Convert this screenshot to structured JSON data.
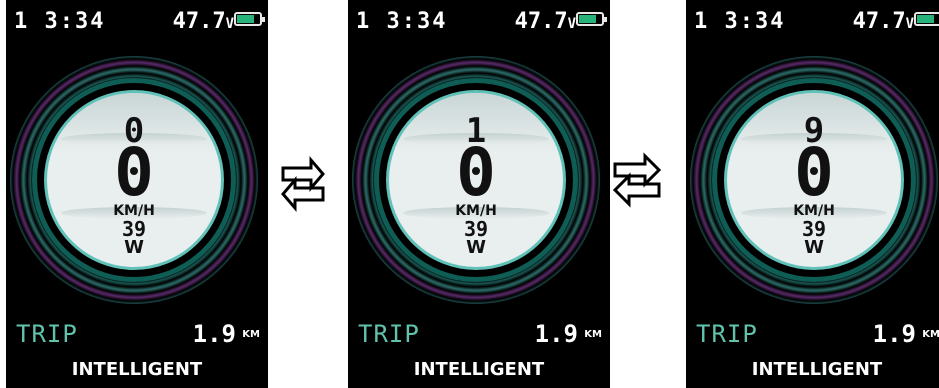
{
  "screens": [
    {
      "time": "1 3:34",
      "voltage": "47.7",
      "voltage_unit": "V",
      "gear": "0",
      "speed": "0",
      "speed_unit": "KM/H",
      "power": "39",
      "power_unit": "W",
      "trip_label": "TRIP",
      "trip_value": "1.9",
      "trip_unit": "KM",
      "mode": "INTELLIGENT"
    },
    {
      "time": "1 3:34",
      "voltage": "47.7",
      "voltage_unit": "V",
      "gear": "1",
      "speed": "0",
      "speed_unit": "KM/H",
      "power": "39",
      "power_unit": "W",
      "trip_label": "TRIP",
      "trip_value": "1.9",
      "trip_unit": "KM",
      "mode": "INTELLIGENT"
    },
    {
      "time": "1 3:34",
      "voltage": "47.7",
      "voltage_unit": "V",
      "gear": "9",
      "speed": "0",
      "speed_unit": "KM/H",
      "power": "39",
      "power_unit": "W",
      "trip_label": "TRIP",
      "trip_value": "1.9",
      "trip_unit": "KM",
      "mode": "INTELLIGENT"
    }
  ],
  "arrows": [
    {
      "icon": "swap-arrows-icon"
    },
    {
      "icon": "swap-arrows-icon"
    }
  ],
  "colors": {
    "accent": "#62c3ad",
    "battery": "#27b37a",
    "ring": "#0f5e56"
  }
}
